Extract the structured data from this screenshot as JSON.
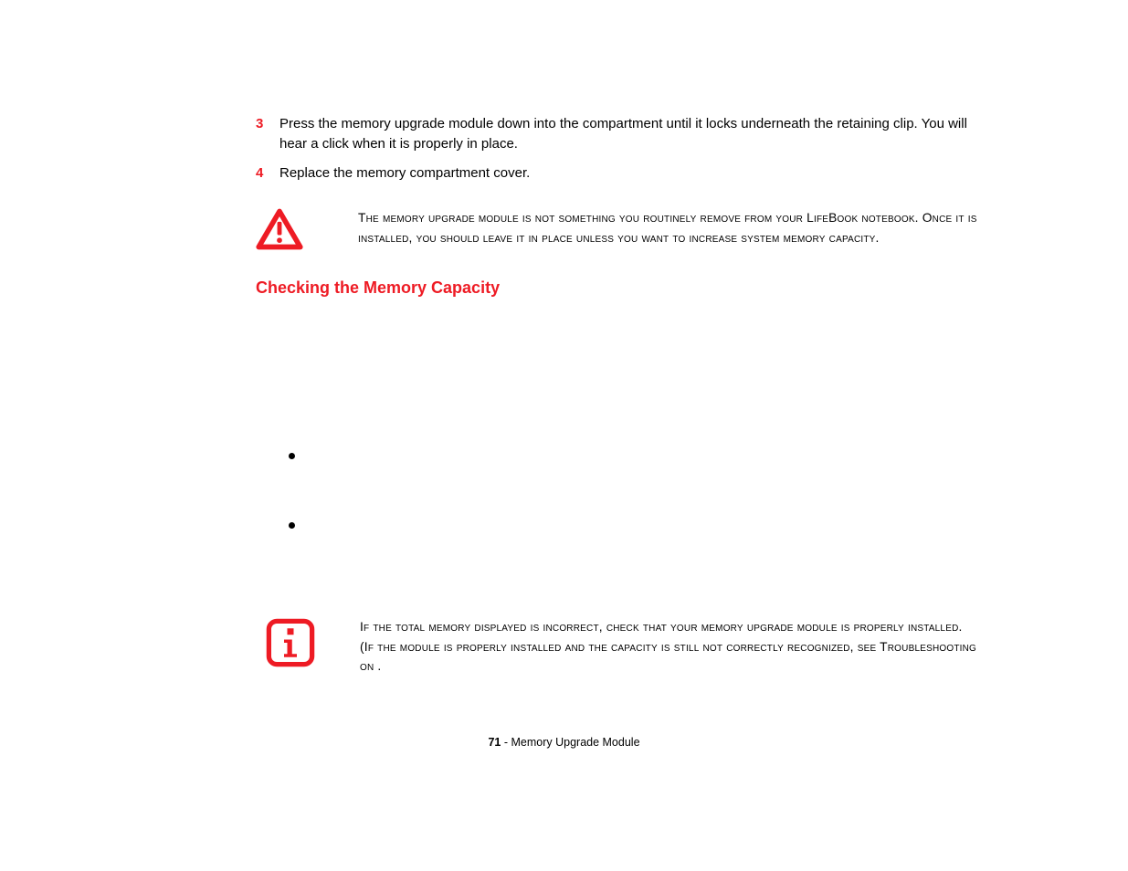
{
  "steps": [
    {
      "num": "3",
      "text": "Press the memory upgrade module down into the compartment until it locks underneath the retaining clip. You will hear a click when it is properly in place."
    },
    {
      "num": "4",
      "text": "Replace the memory compartment cover."
    }
  ],
  "warning_text": "The memory upgrade module is not something you routinely remove from your LifeBook notebook. Once it is installed, you should leave it in place unless you want to increase system memory capacity.",
  "section_heading": "Checking the Memory Capacity",
  "bullets": [
    {
      "text": ""
    },
    {
      "text": ""
    }
  ],
  "info_text": "If the total memory displayed is incorrect, check that your memory upgrade module is properly installed. (If the module is properly installed and the capacity is still not correctly recognized, see Troubleshooting on            .",
  "footer": {
    "page": "71",
    "sep": " - ",
    "title": "Memory Upgrade Module"
  }
}
